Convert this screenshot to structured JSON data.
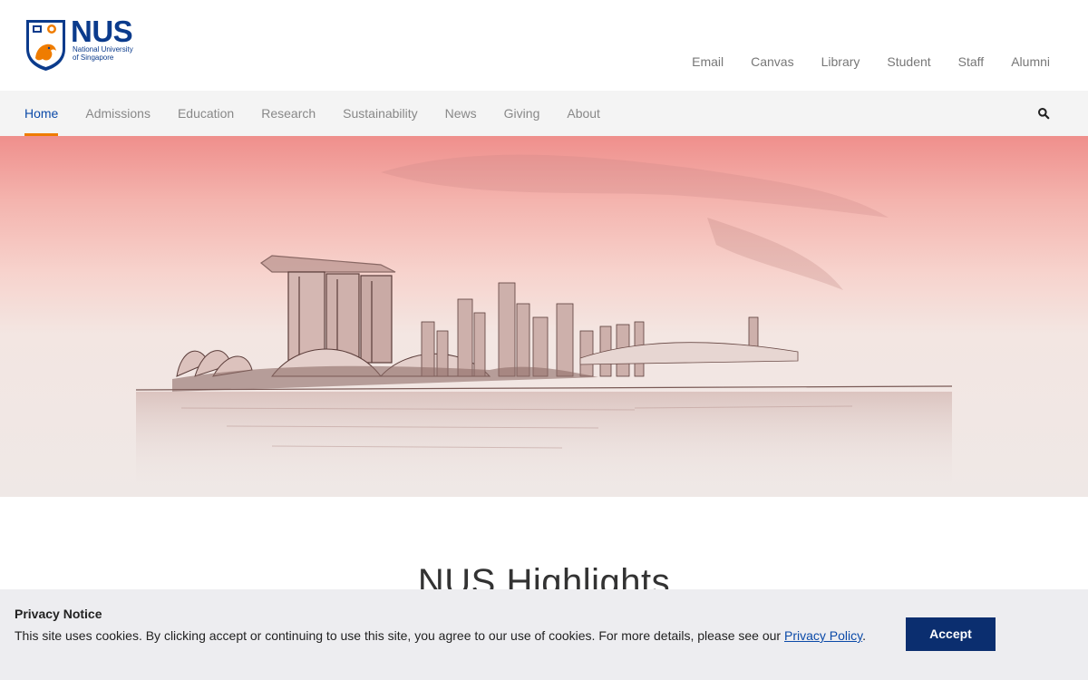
{
  "logo": {
    "name": "NUS",
    "subtitle_line1": "National University",
    "subtitle_line2": "of Singapore"
  },
  "quicklinks": [
    "Email",
    "Canvas",
    "Library",
    "Student",
    "Staff",
    "Alumni"
  ],
  "nav": {
    "items": [
      "Home",
      "Admissions",
      "Education",
      "Research",
      "Sustainability",
      "News",
      "Giving",
      "About"
    ],
    "active": "Home",
    "search_icon": "search-icon"
  },
  "hero": {
    "image": "singapore-skyline-sketch"
  },
  "highlights": {
    "title": "NUS Highlights"
  },
  "cookie": {
    "title": "Privacy Notice",
    "text": "This site uses cookies. By clicking accept or continuing to use this site, you agree to our use of cookies. For more details, please see our ",
    "link": "Privacy Policy",
    "after_link": ".",
    "accept_label": "Accept"
  },
  "colors": {
    "brand_blue": "#0b3b8c",
    "accent_orange": "#ef7c00",
    "accept_bg": "#0b2e6f",
    "nav_bg": "#f4f4f4",
    "cookie_bg": "#ededf0"
  }
}
